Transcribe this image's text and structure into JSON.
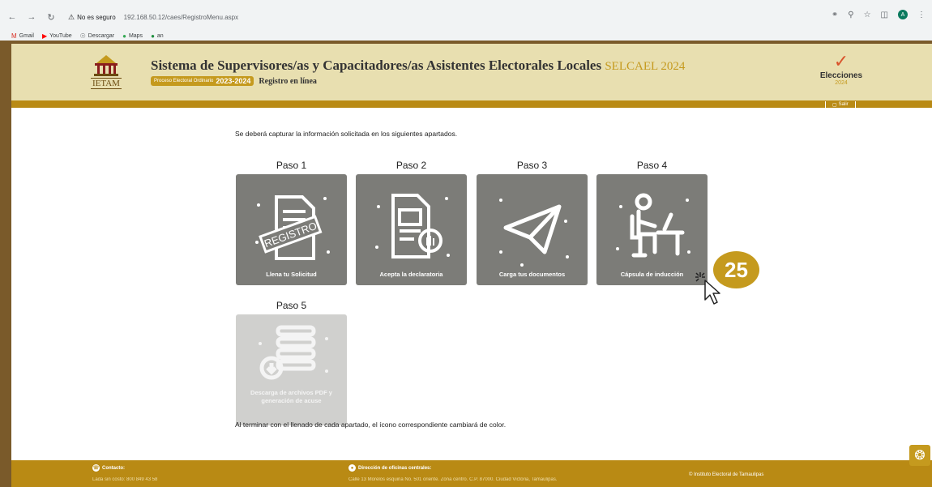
{
  "browser": {
    "security_label": "No es seguro",
    "url": "192.168.50.12/caes/RegistroMenu.aspx",
    "bookmarks": [
      "Gmail",
      "YouTube",
      "Descargar",
      "Maps",
      "an"
    ],
    "profile_initial": "A"
  },
  "header": {
    "logo_left": "IETAM",
    "title": "Sistema de Supervisores/as y Capacitadores/as Asistentes Electorales Locales",
    "brand": "SELCAEL 2024",
    "pill_text": "Proceso Electoral Ordinario",
    "pill_years": "2023-2024",
    "subtitle": "Registro en línea",
    "logo_right_title": "Elecciones",
    "logo_right_year": "2024",
    "logout": "Salir"
  },
  "main": {
    "intro": "Se deberá capturar la información solicitada en los siguientes apartados.",
    "steps": [
      {
        "label": "Paso 1",
        "caption": "Llena tu Solicitud",
        "stamp": "REGISTRO",
        "icon": "registration-document-icon",
        "enabled": true
      },
      {
        "label": "Paso 2",
        "caption": "Acepta la declaratoria",
        "icon": "declaration-document-icon",
        "enabled": true
      },
      {
        "label": "Paso 3",
        "caption": "Carga tus documentos",
        "icon": "paper-plane-icon",
        "enabled": true
      },
      {
        "label": "Paso 4",
        "caption": "Cápsula de inducción",
        "icon": "person-at-desk-icon",
        "enabled": true
      },
      {
        "label": "Paso 5",
        "caption": "Descarga de archivos PDF y generación de acuse",
        "icon": "download-stack-icon",
        "enabled": false
      }
    ],
    "outro": "Al terminar con el llenado de cada apartado, el ícono correspondiente cambiará de color."
  },
  "footer": {
    "contact_title": "Contacto:",
    "contact_phone": "Lada sin costo: 800 849 43 58",
    "address_title": "Dirección de oficinas centrales:",
    "address": "Calle 13 Morelos esquina No. 501 oriente. Zona centro. C.P. 87000. Ciudad Victoria, Tamaulipas.",
    "copyright": "© Instituto Electoral de Tamaulipas"
  },
  "overlay": {
    "step_badge": "25"
  },
  "colors": {
    "header_bg": "#e8dfb0",
    "gold": "#b98a14",
    "card_active": "#7c7c78",
    "card_disabled": "#d0d0ce"
  }
}
